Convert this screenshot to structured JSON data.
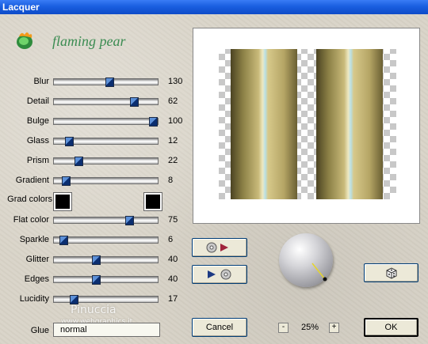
{
  "window": {
    "title": "Lacquer"
  },
  "brand": {
    "name": "flaming pear"
  },
  "controls": [
    {
      "label": "Blur",
      "value": "130",
      "fraction": 0.54
    },
    {
      "label": "Detail",
      "value": "62",
      "fraction": 0.8
    },
    {
      "label": "Bulge",
      "value": "100",
      "fraction": 1.0
    },
    {
      "label": "Glass",
      "value": "12",
      "fraction": 0.12
    },
    {
      "label": "Prism",
      "value": "22",
      "fraction": 0.22
    },
    {
      "label": "Gradient",
      "value": "8",
      "fraction": 0.08
    },
    {
      "label": "Flat color",
      "value": "75",
      "fraction": 0.75
    },
    {
      "label": "Sparkle",
      "value": "6",
      "fraction": 0.06
    },
    {
      "label": "Glitter",
      "value": "40",
      "fraction": 0.4
    },
    {
      "label": "Edges",
      "value": "40",
      "fraction": 0.4
    },
    {
      "label": "Lucidity",
      "value": "17",
      "fraction": 0.17
    }
  ],
  "grad_colors": {
    "label": "Grad colors",
    "left_color": "#000000",
    "right_color": "#000000"
  },
  "glue": {
    "label": "Glue",
    "value": "normal"
  },
  "buttons": {
    "cancel": "Cancel",
    "ok": "OK"
  },
  "zoom": {
    "minus": "-",
    "level": "25%",
    "plus": "+"
  },
  "watermark": {
    "line1": "Pinuccia",
    "line2": "www.webgraphics.it"
  },
  "icons": {
    "brand": "flame-leaf-icon",
    "copy_in": "disc-to-arrow-icon",
    "copy_out": "arrow-to-disc-icon",
    "random": "dice-icon",
    "light": "light-direction-sphere"
  }
}
